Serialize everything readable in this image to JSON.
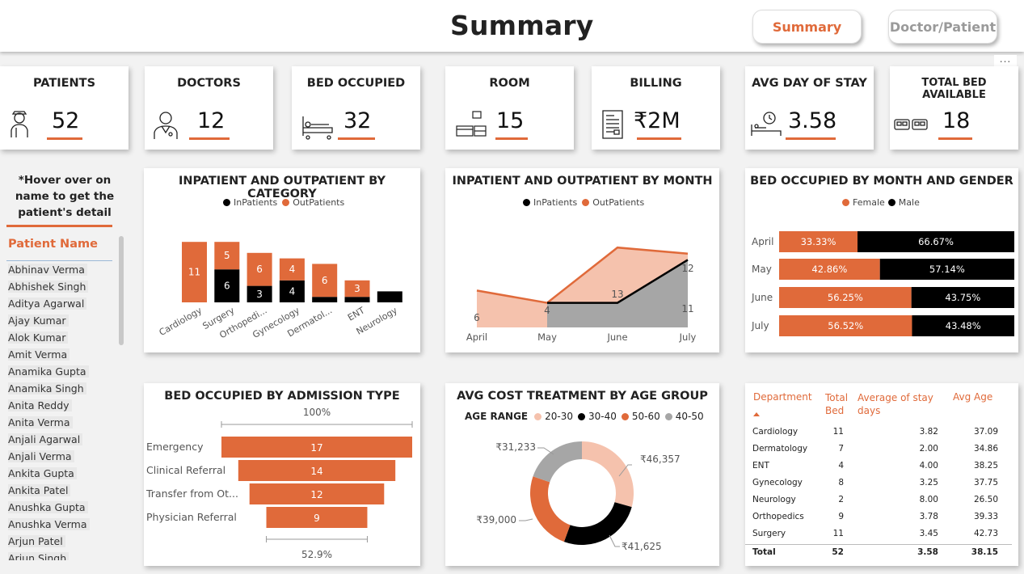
{
  "header": {
    "title": "Summary",
    "nav": {
      "summary_label": "Summary",
      "doctor_label": "Doctor/Patient"
    },
    "more_label": "..."
  },
  "kpis": {
    "patients": {
      "label": "PATIENTS",
      "value": "52",
      "icon": "patient-icon"
    },
    "doctors": {
      "label": "DOCTORS",
      "value": "12",
      "icon": "doctor-icon"
    },
    "bed_occupied": {
      "label": "BED OCCUPIED",
      "value": "32",
      "icon": "hospital-bed-icon"
    },
    "room": {
      "label": "ROOM",
      "value": "15",
      "icon": "room-icon"
    },
    "billing": {
      "label": "BILLING",
      "value": "₹2M",
      "icon": "bill-icon"
    },
    "avg_stay": {
      "label": "AVG DAY OF STAY",
      "value": "3.58",
      "icon": "bed-clock-icon"
    },
    "total_bed": {
      "label": "TOTAL BED AVAILABLE",
      "value": "18",
      "icon": "beds-icon"
    }
  },
  "sidebar": {
    "hover_note": "*Hover over on name to get the patient's detail",
    "header": "Patient Name",
    "patients": [
      "Abhinav Verma",
      "Abhishek Singh",
      "Aditya Agarwal",
      "Ajay Kumar",
      "Alok Kumar",
      "Amit Verma",
      "Anamika Gupta",
      "Anamika Singh",
      "Anita Reddy",
      "Anita Verma",
      "Anjali Agarwal",
      "Anjali Verma",
      "Ankita Gupta",
      "Ankita Patel",
      "Anushka Gupta",
      "Anushka Verma",
      "Arjun Patel",
      "Arjun Singh"
    ]
  },
  "colors": {
    "accent": "#e06a3a",
    "black": "#000000",
    "peach": "#f5c2ad",
    "gray": "#a6a6a6"
  },
  "chart_data": [
    {
      "type": "bar",
      "stacked": true,
      "title": "INPATIENT AND OUTPATIENT BY CATEGORY",
      "legend": [
        "InPatients",
        "OutPatients"
      ],
      "categories": [
        "Cardiology",
        "Surgery",
        "Orthopedi...",
        "Gynecology",
        "Dermatol...",
        "ENT",
        "Neurology"
      ],
      "series": [
        {
          "name": "InPatients",
          "values": [
            0,
            6,
            3,
            4,
            1,
            1,
            2
          ],
          "labels": [
            "",
            "6",
            "3",
            "4",
            "",
            "",
            ""
          ]
        },
        {
          "name": "OutPatients",
          "values": [
            11,
            5,
            6,
            4,
            6,
            3,
            0
          ],
          "labels": [
            "11",
            "5",
            "6",
            "4",
            "6",
            "3",
            ""
          ]
        }
      ]
    },
    {
      "type": "area",
      "title": "INPATIENT AND OUTPATIENT BY MONTH",
      "legend": [
        "InPatients",
        "OutPatients"
      ],
      "categories": [
        "April",
        "May",
        "June",
        "July"
      ],
      "series": [
        {
          "name": "InPatients",
          "values": [
            null,
            4,
            4,
            11
          ],
          "labels": [
            "",
            "",
            "",
            "11"
          ]
        },
        {
          "name": "OutPatients",
          "values": [
            6,
            4,
            13,
            12
          ],
          "labels": [
            "6",
            "4",
            "13",
            "12"
          ]
        }
      ]
    },
    {
      "type": "bar",
      "orientation": "horizontal",
      "stacked100": true,
      "title": "BED OCCUPIED BY MONTH AND GENDER",
      "legend": [
        "Female",
        "Male"
      ],
      "categories": [
        "April",
        "May",
        "June",
        "July"
      ],
      "series": [
        {
          "name": "Female",
          "values": [
            33.33,
            42.86,
            56.25,
            56.52
          ],
          "labels": [
            "33.33%",
            "42.86%",
            "56.25%",
            "56.52%"
          ]
        },
        {
          "name": "Male",
          "values": [
            66.67,
            57.14,
            43.75,
            43.48
          ],
          "labels": [
            "66.67%",
            "57.14%",
            "43.75%",
            "43.48%"
          ]
        }
      ]
    },
    {
      "type": "bar",
      "subtype": "funnel",
      "title": "BED OCCUPIED BY ADMISSION TYPE",
      "top_label": "100%",
      "bottom_label": "52.9%",
      "categories": [
        "Emergency",
        "Clinical Referral",
        "Transfer from Ot...",
        "Physician Referral"
      ],
      "values": [
        17,
        14,
        12,
        9
      ]
    },
    {
      "type": "pie",
      "subtype": "donut",
      "title": "AVG COST TREATMENT BY AGE GROUP",
      "legend_title": "AGE RANGE",
      "legend": [
        "20-30",
        "30-40",
        "50-60",
        "40-50"
      ],
      "slices": [
        {
          "name": "20-30",
          "value": 46357,
          "label": "₹46,357"
        },
        {
          "name": "30-40",
          "value": 41625,
          "label": "₹41,625"
        },
        {
          "name": "50-60",
          "value": 39000,
          "label": "₹39,000"
        },
        {
          "name": "40-50",
          "value": 31233,
          "label": "₹31,233"
        }
      ]
    }
  ],
  "dept_table": {
    "headers": [
      "Department",
      "Total Bed",
      "Average of stay days",
      "Avg Age"
    ],
    "rows": [
      [
        "Cardiology",
        "11",
        "3.82",
        "37.09"
      ],
      [
        "Dermatology",
        "7",
        "2.00",
        "34.86"
      ],
      [
        "ENT",
        "4",
        "4.00",
        "38.25"
      ],
      [
        "Gynecology",
        "8",
        "3.25",
        "37.75"
      ],
      [
        "Neurology",
        "2",
        "8.00",
        "26.50"
      ],
      [
        "Orthopedics",
        "9",
        "3.78",
        "39.33"
      ],
      [
        "Surgery",
        "11",
        "3.45",
        "42.73"
      ]
    ],
    "total": [
      "Total",
      "52",
      "3.58",
      "38.15"
    ]
  }
}
